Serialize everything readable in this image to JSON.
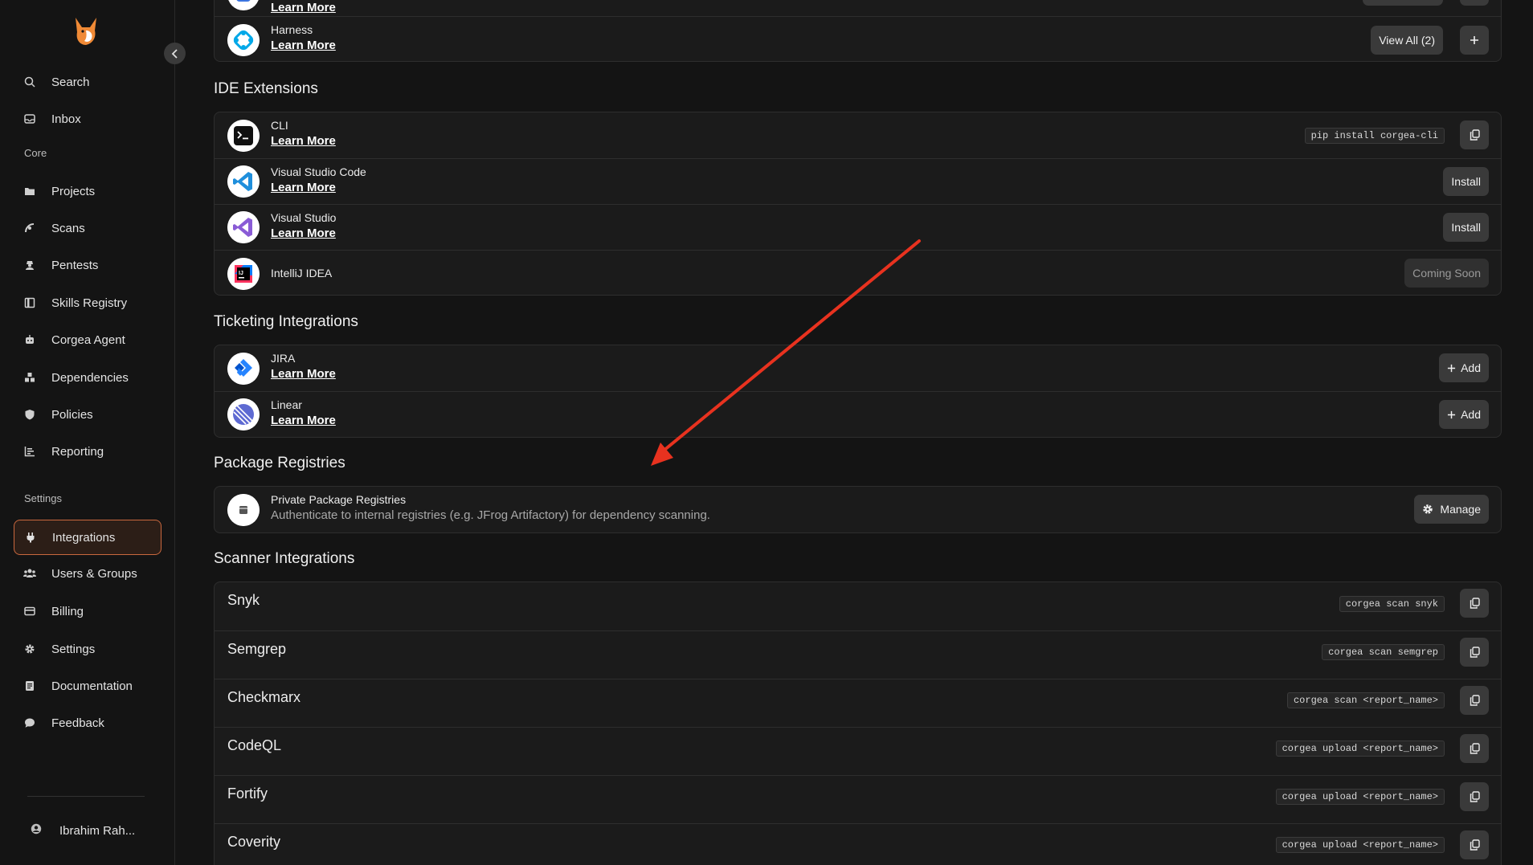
{
  "sidebar": {
    "search": "Search",
    "inbox": "Inbox",
    "core_label": "Core",
    "core_items": [
      "Projects",
      "Scans",
      "Pentests",
      "Skills Registry",
      "Corgea Agent",
      "Dependencies",
      "Policies",
      "Reporting"
    ],
    "settings_label": "Settings",
    "settings_items": [
      "Integrations",
      "Users & Groups",
      "Billing",
      "Settings",
      "Documentation",
      "Feedback"
    ],
    "user_name": "Ibrahim Rah..."
  },
  "top_card": {
    "partial_link": "Learn More",
    "harness_name": "Harness",
    "harness_link": "Learn More",
    "view_all": "View All (2)"
  },
  "ide": {
    "title": "IDE Extensions",
    "cli_name": "CLI",
    "cli_link": "Learn More",
    "cli_cmd": "pip install corgea-cli",
    "vscode_name": "Visual Studio Code",
    "vscode_link": "Learn More",
    "vscode_btn": "Install",
    "vs_name": "Visual Studio",
    "vs_link": "Learn More",
    "vs_btn": "Install",
    "idea_name": "IntelliJ IDEA",
    "idea_btn": "Coming Soon"
  },
  "ticketing": {
    "title": "Ticketing Integrations",
    "jira_name": "JIRA",
    "jira_link": "Learn More",
    "jira_btn": "Add",
    "linear_name": "Linear",
    "linear_link": "Learn More",
    "linear_btn": "Add"
  },
  "packages": {
    "title": "Package Registries",
    "name": "Private Package Registries",
    "desc": "Authenticate to internal registries (e.g. JFrog Artifactory) for dependency scanning.",
    "btn": "Manage"
  },
  "scanners": {
    "title": "Scanner Integrations",
    "items": [
      {
        "name": "Snyk",
        "cmd": "corgea scan snyk"
      },
      {
        "name": "Semgrep",
        "cmd": "corgea scan semgrep"
      },
      {
        "name": "Checkmarx",
        "cmd": "corgea scan <report_name>"
      },
      {
        "name": "CodeQL",
        "cmd": "corgea upload <report_name>"
      },
      {
        "name": "Fortify",
        "cmd": "corgea upload <report_name>"
      },
      {
        "name": "Coverity",
        "cmd": "corgea upload <report_name>"
      }
    ]
  },
  "colors": {
    "accent": "#c9683e",
    "annotation_arrow": "#e8321f"
  }
}
